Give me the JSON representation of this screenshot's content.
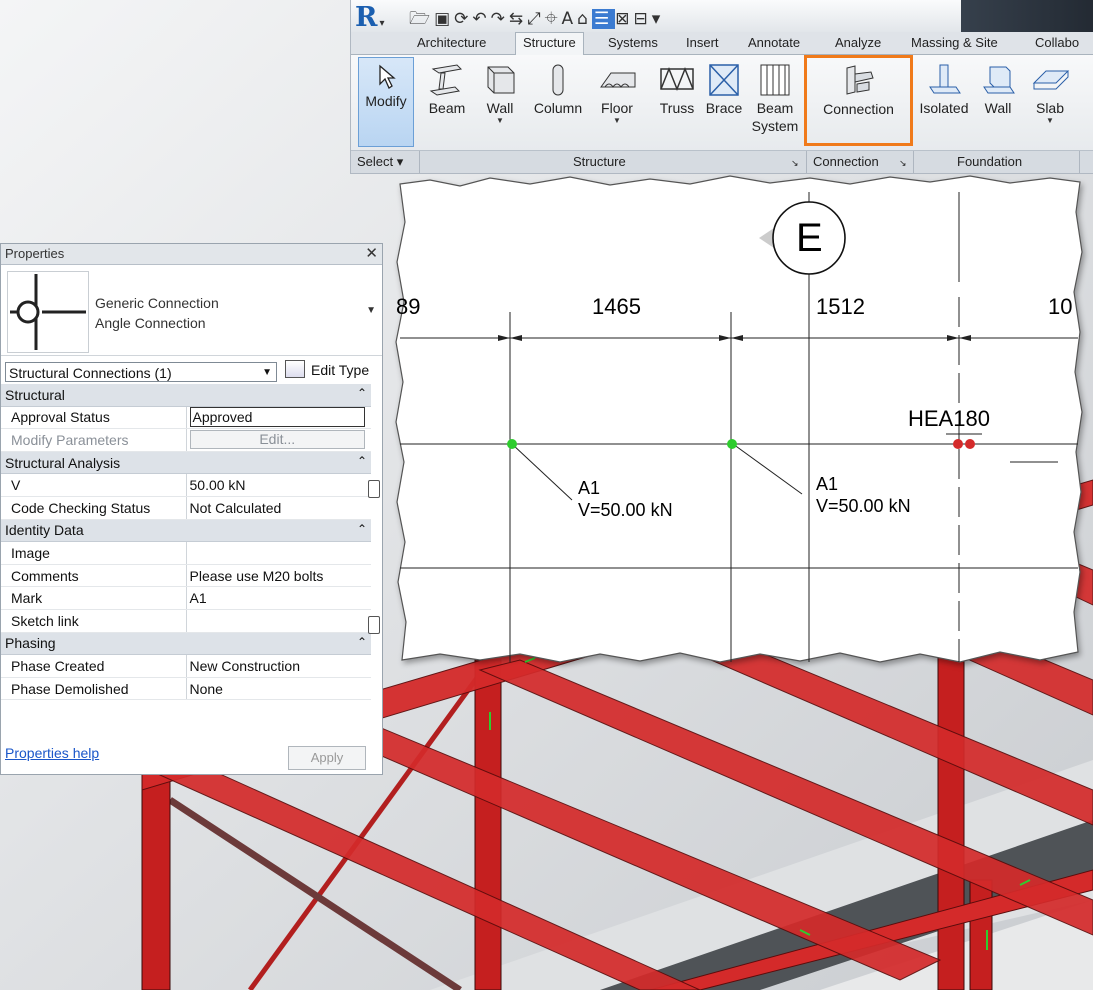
{
  "ribbon": {
    "app_logo": "R",
    "tabs": [
      "Architecture",
      "Structure",
      "Systems",
      "Insert",
      "Annotate",
      "Analyze",
      "Massing & Site",
      "Collabo"
    ],
    "active_tab": "Structure",
    "tools": {
      "modify": "Modify",
      "beam": "Beam",
      "wall": "Wall",
      "column": "Column",
      "floor": "Floor",
      "truss": "Truss",
      "brace": "Brace",
      "beam_system_1": "Beam",
      "beam_system_2": "System",
      "connection": "Connection",
      "isolated": "Isolated",
      "fwall": "Wall",
      "slab": "Slab"
    },
    "panels": {
      "select": "Select",
      "structure": "Structure",
      "connection": "Connection",
      "foundation": "Foundation"
    }
  },
  "drawing": {
    "grid_bubble": "E",
    "dims": [
      "89",
      "1465",
      "1512",
      "10"
    ],
    "beam_label": "HEA180",
    "tag1_mark": "A1",
    "tag1_force": "V=50.00 kN",
    "tag2_mark": "A1",
    "tag2_force": "V=50.00 kN"
  },
  "properties": {
    "title": "Properties",
    "family": "Generic Connection",
    "type": "Angle Connection",
    "filter": "Structural Connections (1)",
    "edit_type": "Edit Type",
    "groups": {
      "structural": "Structural",
      "analysis": "Structural Analysis",
      "identity": "Identity Data",
      "phasing": "Phasing"
    },
    "rows": {
      "approval_k": "Approval Status",
      "approval_v": "Approved",
      "modparams_k": "Modify Parameters",
      "modparams_v": "Edit...",
      "v_k": "V",
      "v_v": "50.00 kN",
      "ccs_k": "Code Checking Status",
      "ccs_v": "Not Calculated",
      "image_k": "Image",
      "image_v": "",
      "comments_k": "Comments",
      "comments_v": "Please use M20 bolts",
      "mark_k": "Mark",
      "mark_v": "A1",
      "sketch_k": "Sketch link",
      "sketch_v": "",
      "pcreated_k": "Phase Created",
      "pcreated_v": "New Construction",
      "pdemolished_k": "Phase Demolished",
      "pdemolished_v": "None"
    },
    "help": "Properties help",
    "apply": "Apply"
  },
  "colors": {
    "steel_red": "#d42a2a",
    "highlight_orange": "#f07a1a",
    "point_green": "#2ecc2e",
    "ribbon_blue": "#1b5fb0"
  }
}
